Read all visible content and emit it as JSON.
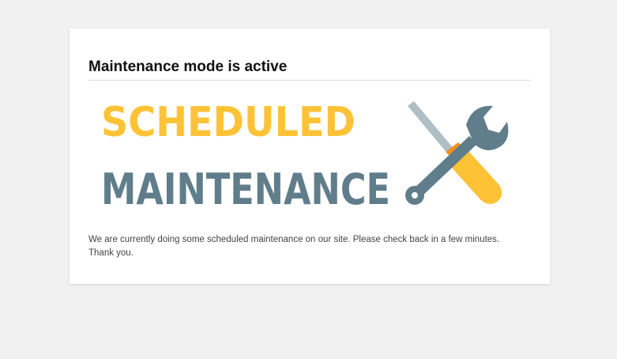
{
  "maintenance": {
    "title": "Maintenance mode is active",
    "banner": {
      "line1": "SCHEDULED",
      "line2": "MAINTENANCE",
      "line1_color": "#FDC236",
      "line2_color": "#607D8B"
    },
    "icons": {
      "screwdriver": "screwdriver-icon",
      "wrench": "wrench-icon"
    },
    "message": "We are currently doing some scheduled maintenance on our site. Please check back in a few minutes. Thank you."
  }
}
